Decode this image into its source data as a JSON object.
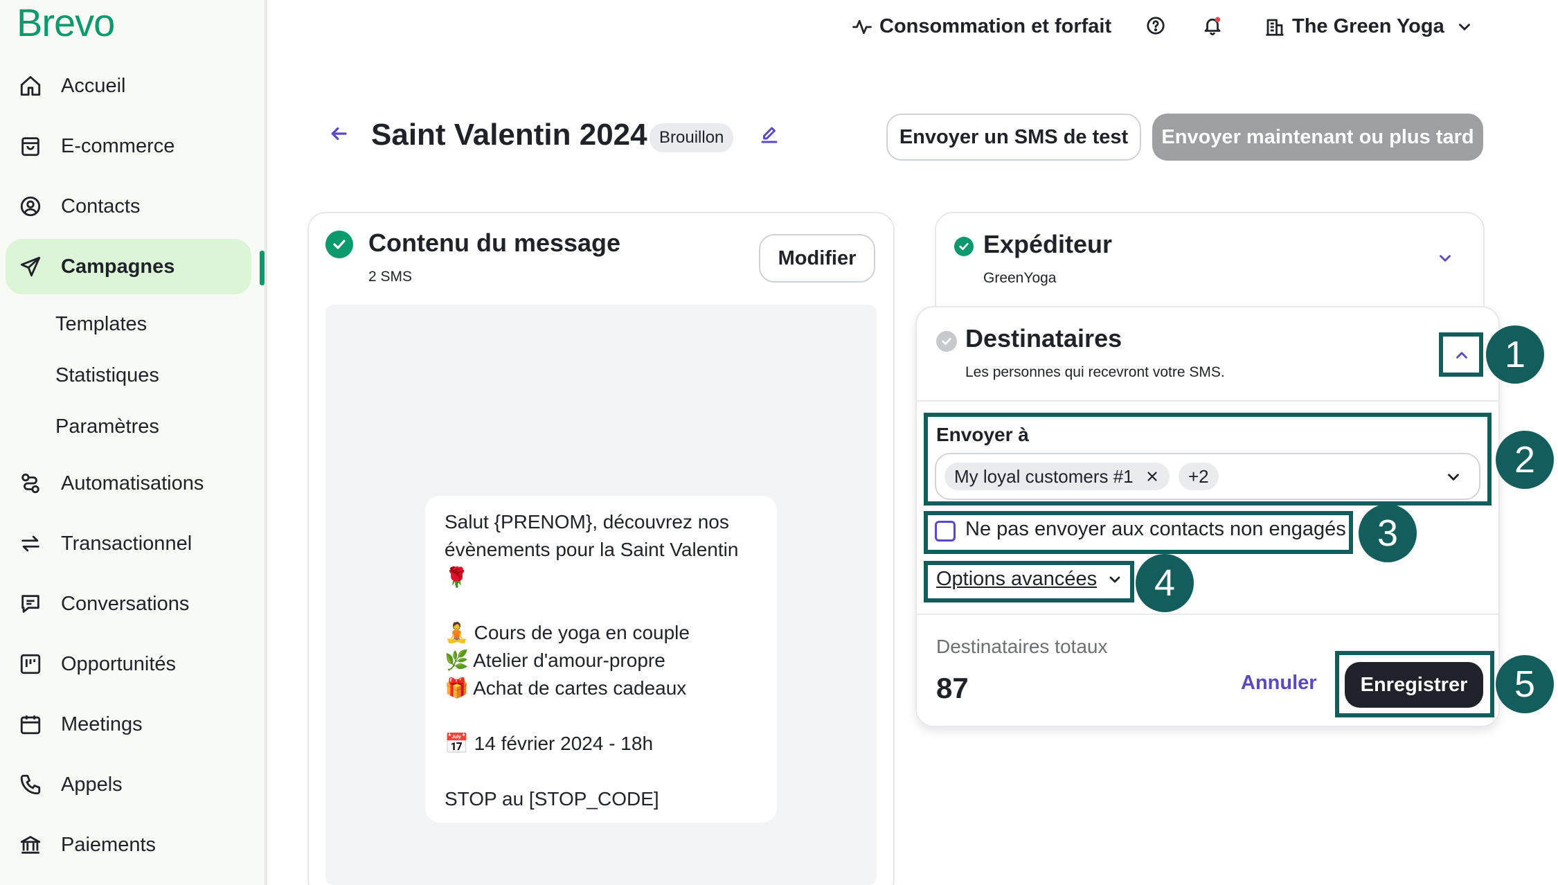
{
  "brand": {
    "logo": "Brevo",
    "accent": "#0b996e",
    "annotation_color": "#135e5c"
  },
  "sidebar": {
    "items": [
      {
        "label": "Accueil",
        "icon": "home-icon"
      },
      {
        "label": "E-commerce",
        "icon": "shopping-bag-icon"
      },
      {
        "label": "Contacts",
        "icon": "contact-icon"
      },
      {
        "label": "Campagnes",
        "icon": "send-icon",
        "active": true
      },
      {
        "label": "Automatisations",
        "icon": "automation-icon"
      },
      {
        "label": "Transactionnel",
        "icon": "transfer-icon"
      },
      {
        "label": "Conversations",
        "icon": "chat-icon"
      },
      {
        "label": "Opportunités",
        "icon": "kanban-icon"
      },
      {
        "label": "Meetings",
        "icon": "calendar-icon"
      },
      {
        "label": "Appels",
        "icon": "phone-icon"
      },
      {
        "label": "Paiements",
        "icon": "bank-icon"
      }
    ],
    "sub_items": [
      "Templates",
      "Statistiques",
      "Paramètres"
    ]
  },
  "topbar": {
    "usage": "Consommation et forfait",
    "account": "The Green Yoga"
  },
  "header": {
    "title": "Saint Valentin 2024",
    "status": "Brouillon",
    "test_button": "Envoyer un SMS de test",
    "send_button": "Envoyer maintenant ou plus tard"
  },
  "content_card": {
    "title": "Contenu du message",
    "subtitle": "2 SMS",
    "edit_button": "Modifier",
    "sms_lines": [
      "Salut {PRENOM}, découvrez nos",
      "évènements pour la Saint Valentin",
      "🌹",
      "",
      "🧘 Cours de yoga en couple",
      "🌿 Atelier d'amour-propre",
      "🎁 Achat de cartes cadeaux",
      "",
      "📅 14 février 2024 - 18h",
      "",
      "STOP au [STOP_CODE]"
    ]
  },
  "sender_card": {
    "title": "Expéditeur",
    "subtitle": "GreenYoga"
  },
  "recipients_card": {
    "title": "Destinataires",
    "subtitle": "Les personnes qui recevront votre SMS.",
    "send_to_label": "Envoyer à",
    "chip_list": "My loyal customers #1",
    "chip_more": "+2",
    "exclude_label": "Ne pas envoyer aux contacts non engagés",
    "advanced_options": "Options avancées",
    "total_label": "Destinataires totaux",
    "total_value": "87",
    "cancel_button": "Annuler",
    "save_button": "Enregistrer"
  },
  "annotations": [
    "1",
    "2",
    "3",
    "4",
    "5"
  ]
}
